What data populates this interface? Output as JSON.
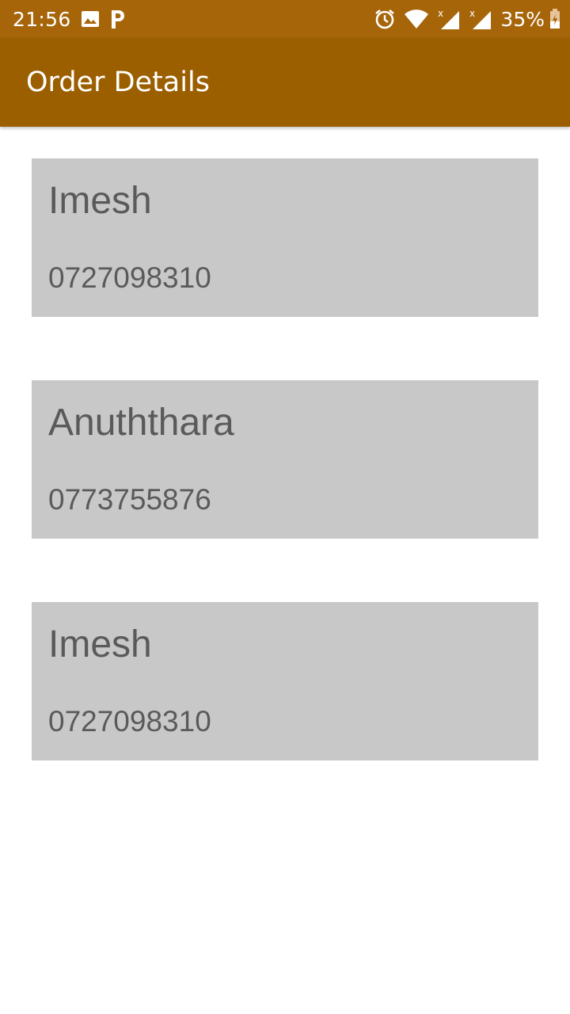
{
  "status_bar": {
    "time": "21:56",
    "battery": "35%",
    "icons": [
      "image-icon",
      "parking-icon",
      "alarm-icon",
      "wifi-icon",
      "signal-icon",
      "signal-icon",
      "battery-charging-icon"
    ]
  },
  "app_bar": {
    "title": "Order Details",
    "color": "#9b5f00"
  },
  "orders": [
    {
      "name": "Imesh",
      "phone": "0727098310"
    },
    {
      "name": "Anuththara",
      "phone": "0773755876"
    },
    {
      "name": "Imesh",
      "phone": "0727098310"
    }
  ]
}
